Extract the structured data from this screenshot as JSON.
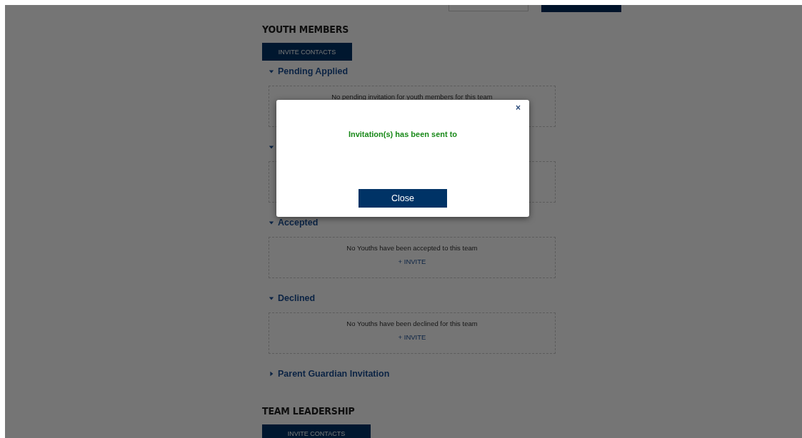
{
  "youth_members": {
    "title": "YOUTH MEMBERS",
    "invite_button": "INVITE CONTACTS",
    "sections": [
      {
        "label": "Pending Applied",
        "expanded": true,
        "message": "No pending invitation for youth members for this team"
      },
      {
        "expanded": true
      },
      {
        "label": "Accepted",
        "expanded": true,
        "message": "No Youths have been accepted to this team",
        "invite": "+ INVITE"
      },
      {
        "label": "Declined",
        "expanded": true,
        "message": "No Youths have been declined for this team",
        "invite": "+ INVITE"
      },
      {
        "label": "Parent Guardian Invitation",
        "expanded": false
      }
    ]
  },
  "team_leadership": {
    "title": "TEAM LEADERSHIP",
    "invite_button": "INVITE CONTACTS"
  },
  "dialog": {
    "close_symbol": "×",
    "message": "Invitation(s) has been sent to",
    "button": "Close"
  }
}
